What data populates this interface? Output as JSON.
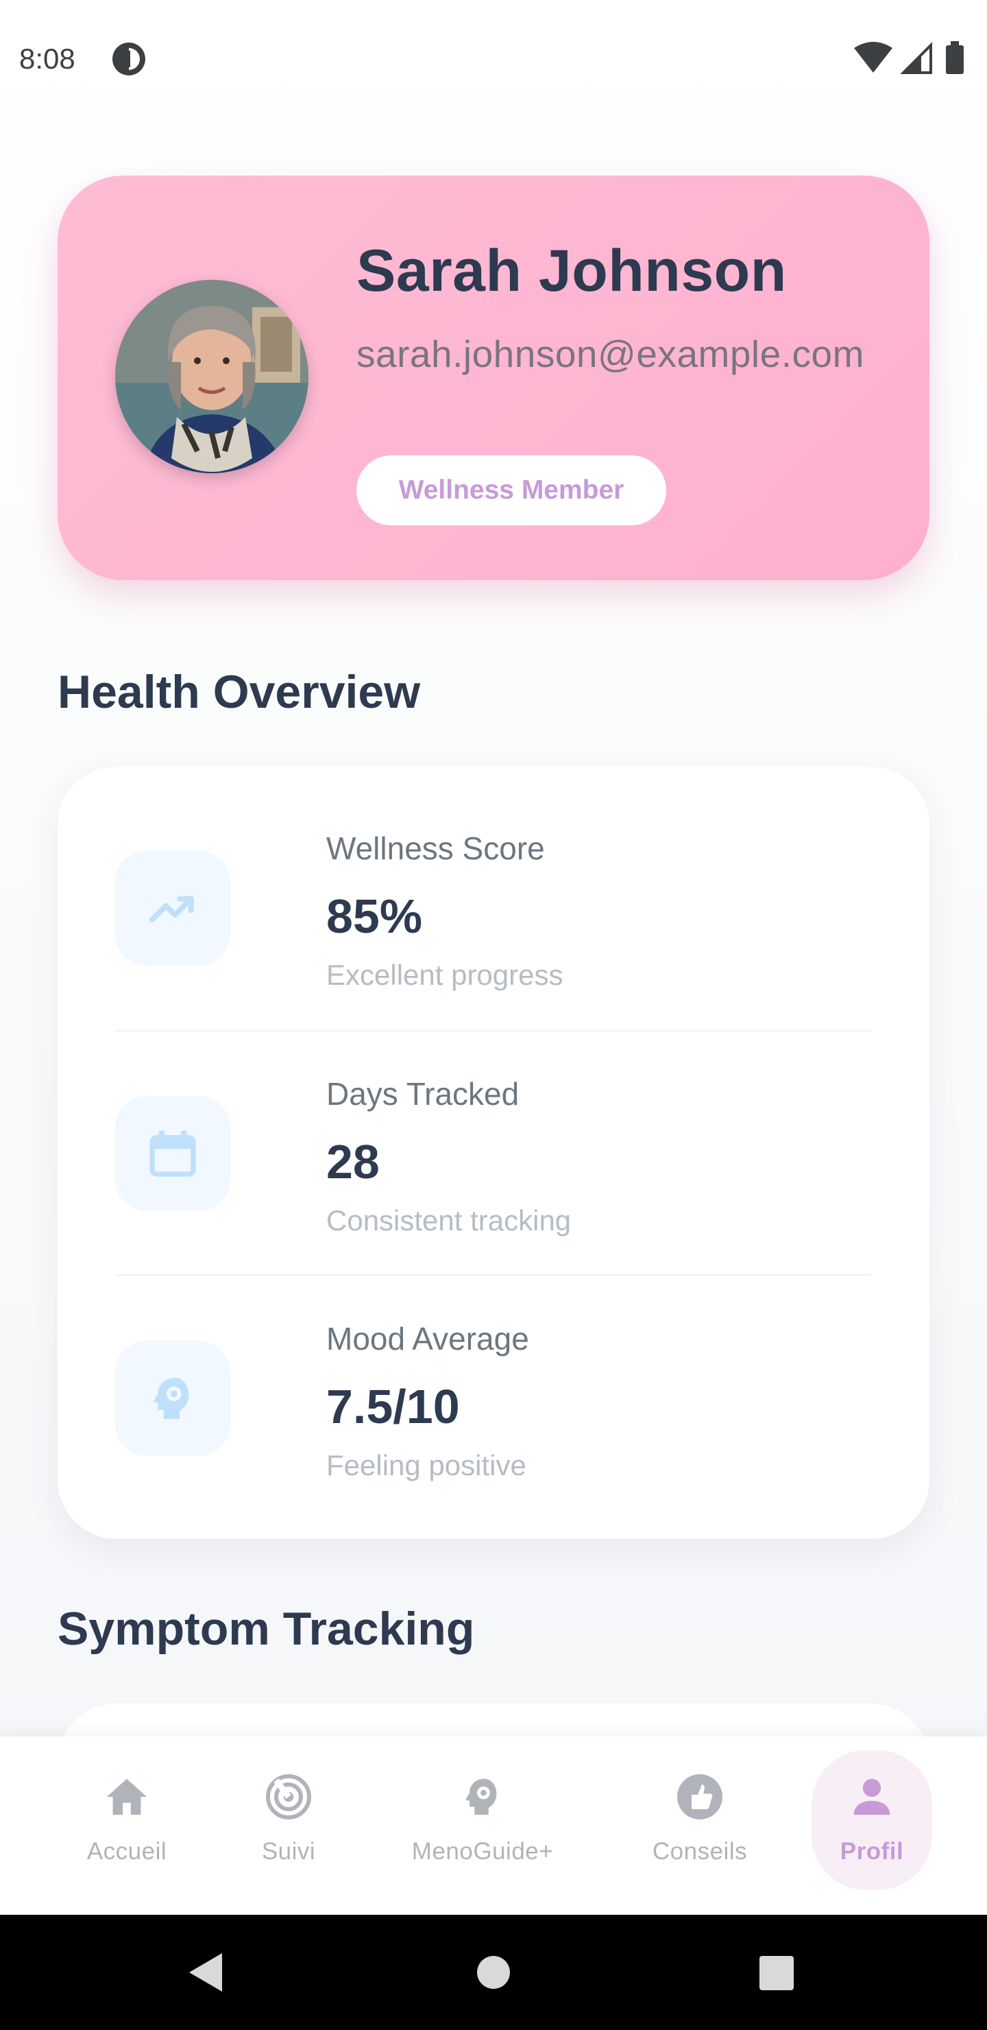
{
  "status_bar": {
    "time": "8:08"
  },
  "profile": {
    "name": "Sarah Johnson",
    "email": "sarah.johnson@example.com",
    "badge": "Wellness Member"
  },
  "health_overview": {
    "title": "Health Overview",
    "stats": [
      {
        "label": "Wellness Score",
        "value": "85%",
        "subtitle": "Excellent progress",
        "icon": "trending-up-icon"
      },
      {
        "label": "Days Tracked",
        "value": "28",
        "subtitle": "Consistent tracking",
        "icon": "calendar-icon"
      },
      {
        "label": "Mood Average",
        "value": "7.5/10",
        "subtitle": "Feeling positive",
        "icon": "psychology-icon"
      }
    ]
  },
  "symptom_tracking": {
    "title": "Symptom Tracking"
  },
  "bottom_nav": {
    "items": [
      {
        "label": "Accueil",
        "icon": "home-icon"
      },
      {
        "label": "Suivi",
        "icon": "radar-icon"
      },
      {
        "label": "MenoGuide+",
        "icon": "psychology-icon"
      },
      {
        "label": "Conseils",
        "icon": "thumb-up-icon"
      },
      {
        "label": "Profil",
        "icon": "person-icon",
        "active": true
      }
    ]
  },
  "colors": {
    "accent": "#c79ad8",
    "profile_card": "#ffb6d2",
    "text_dark": "#2d3a50",
    "icon_blue": "#bfe0fb"
  }
}
